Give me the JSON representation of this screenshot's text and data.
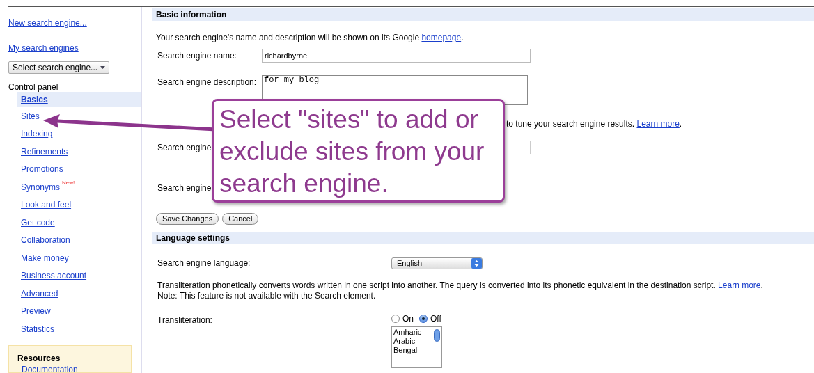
{
  "sidebar": {
    "links": [
      "New search engine...",
      "My search engines"
    ],
    "engine_select": {
      "value": "Select search engine..."
    },
    "control_panel": {
      "title": "Control panel",
      "items": [
        {
          "label": "Basics",
          "selected": true
        },
        {
          "label": "Sites",
          "selected": false
        },
        {
          "label": "Indexing",
          "selected": false
        },
        {
          "label": "Refinements",
          "selected": false
        },
        {
          "label": "Promotions",
          "selected": false
        },
        {
          "label": "Synonyms",
          "selected": false,
          "badge": "New!"
        },
        {
          "label": "Look and feel",
          "selected": false
        },
        {
          "label": "Get code",
          "selected": false
        },
        {
          "label": "Collaboration",
          "selected": false
        },
        {
          "label": "Make money",
          "selected": false
        },
        {
          "label": "Business account",
          "selected": false
        },
        {
          "label": "Advanced",
          "selected": false
        },
        {
          "label": "Preview",
          "selected": false
        },
        {
          "label": "Statistics",
          "selected": false
        }
      ]
    },
    "resources": {
      "title": "Resources",
      "items": [
        "Documentation"
      ]
    }
  },
  "basic_information": {
    "heading": "Basic information",
    "intro": {
      "text": "Your search engine's name and description will be shown on its Google ",
      "link": "homepage",
      "suffix": "."
    },
    "fields": [
      {
        "label": "Search engine name:",
        "kind": "input",
        "value": "richardbyrne"
      },
      {
        "label": "Search engine description:",
        "kind": "textarea",
        "value": "for my blog"
      }
    ],
    "keywords_note": {
      "text": "to tune your search engine results.",
      "link": "Learn more",
      "suffix": "."
    },
    "more_fields": [
      {
        "label": "Search engine",
        "kind": "input"
      },
      {
        "label": "Search engine",
        "kind": "none"
      }
    ],
    "buttons": [
      "Save Changes",
      "Cancel"
    ]
  },
  "language_settings": {
    "heading": "Language settings",
    "language": {
      "label": "Search engine language:",
      "value": "English"
    },
    "note": {
      "text": "Transliteration phonetically converts words written in one script into another. The query is converted into its phonetic equivalent in the destination script.",
      "link": "Learn more",
      "suffix": ".",
      "line2": "Note: This feature is not available with the Search element."
    },
    "transliteration": {
      "label": "Transliteration:",
      "options": [
        {
          "label": "On",
          "selected": false
        },
        {
          "label": "Off",
          "selected": true
        }
      ]
    },
    "languages": [
      "Amharic",
      "Arabic",
      "Bengali"
    ]
  },
  "callout": {
    "text": "Select \"sites\" to add or exclude sites from your search engine."
  }
}
